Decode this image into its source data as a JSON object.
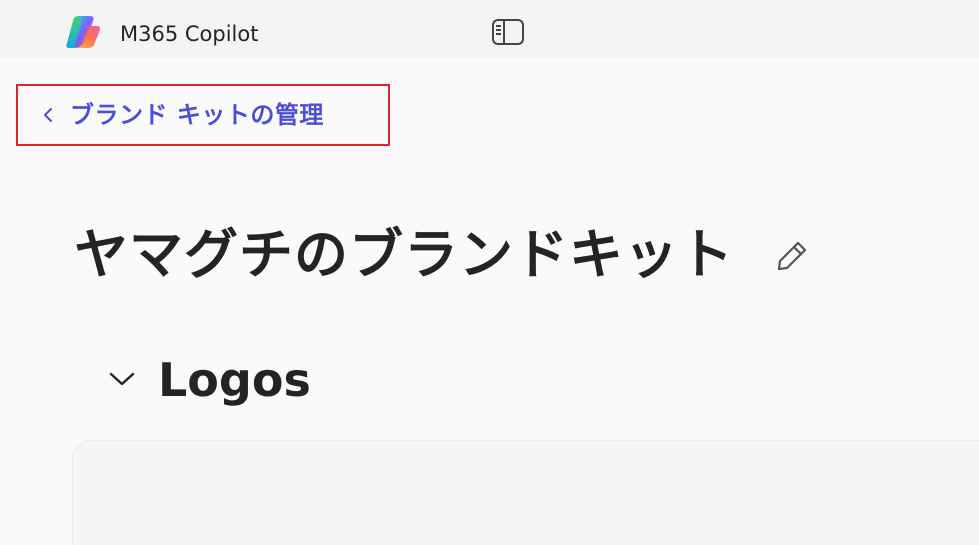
{
  "header": {
    "app_title": "M365 Copilot",
    "logo_icon": "copilot-logo-icon",
    "sidebar_toggle_icon": "sidebar-toggle-icon"
  },
  "nav": {
    "back_label": "ブランド キットの管理",
    "back_icon": "chevron-left-icon"
  },
  "page": {
    "title": "ヤマグチのブランドキット",
    "edit_icon": "pencil-icon"
  },
  "section": {
    "title": "Logos",
    "toggle_icon": "chevron-down-icon",
    "expanded": true
  },
  "colors": {
    "accent": "#4b4fd8",
    "highlight_border": "#d6262f",
    "text": "#242424",
    "background": "#fafafa",
    "titlebar": "#f3f3f3"
  }
}
